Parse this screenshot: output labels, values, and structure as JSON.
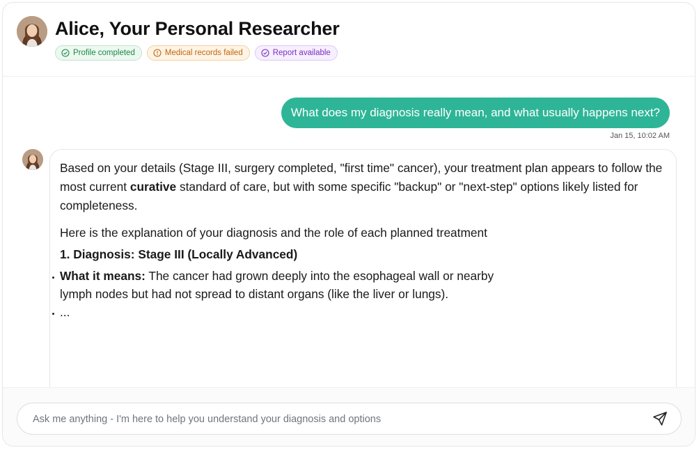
{
  "header": {
    "title": "Alice, Your Personal Researcher",
    "badges": [
      {
        "label": "Profile completed",
        "status": "ok",
        "icon": "check-circle-icon",
        "color": "#1a8a46"
      },
      {
        "label": "Medical records failed",
        "status": "warn",
        "icon": "alert-circle-icon",
        "color": "#c2660a"
      },
      {
        "label": "Report available",
        "status": "info",
        "icon": "check-circle-icon",
        "color": "#7b2fc1"
      }
    ]
  },
  "chat": {
    "user_message": "What does my diagnosis really mean, and what usually happens next?",
    "user_timestamp": "Jan 15, 10:02 AM",
    "assistant": {
      "p1_before": "Based on your details (Stage III, surgery completed, \"first time\" cancer), your treatment plan appears to follow the most current ",
      "p1_bold": "curative",
      "p1_after": " standard of care, but with some specific \"backup\" or \"next-step\" options likely listed for completeness.",
      "p2": "Here is the explanation of your diagnosis and the role of each planned treatment",
      "heading": "1. Diagnosis: Stage III (Locally Advanced)",
      "bullets": [
        {
          "bold": "What it means:",
          "text": " The cancer had grown deeply into the esophageal wall or nearby lymph nodes but had not spread to distant organs (like the liver or lungs)."
        },
        {
          "bold": "",
          "text": "..."
        }
      ]
    }
  },
  "composer": {
    "placeholder": "Ask me anything - I'm here to help you understand your diagnosis and options",
    "send_icon": "send-icon"
  },
  "colors": {
    "accent": "#2eb597"
  }
}
